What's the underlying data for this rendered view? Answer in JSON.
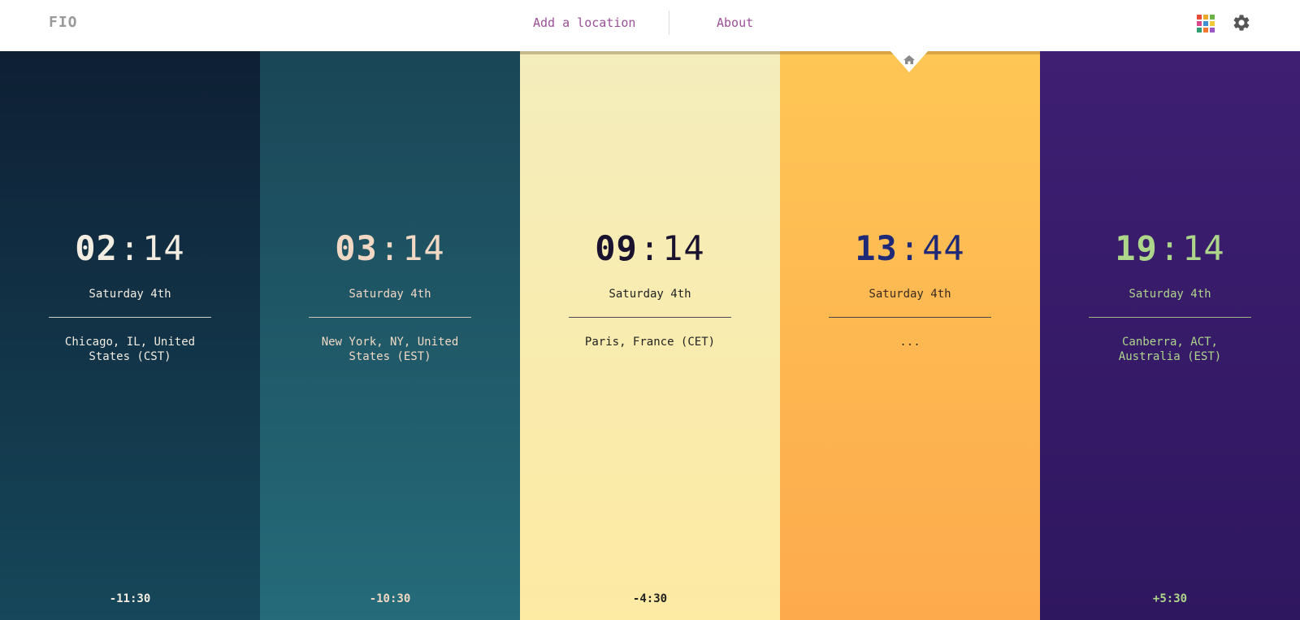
{
  "header": {
    "logo": "FIO",
    "add_location": "Add a location",
    "about": "About",
    "apps_icon": "apps-grid-icon",
    "settings_icon": "gear-icon",
    "accent_color": "#9b4f96"
  },
  "home_marker_icon": "home-icon",
  "locations": [
    {
      "hours": "02",
      "minutes": "14",
      "date": "Saturday 4th",
      "city": "Chicago, IL, United States (CST)",
      "offset": "-11:30",
      "background": "#0e1f34"
    },
    {
      "hours": "03",
      "minutes": "14",
      "date": "Saturday 4th",
      "city": "New York, NY, United States (EST)",
      "offset": "-10:30",
      "background": "#1a4657"
    },
    {
      "hours": "09",
      "minutes": "14",
      "date": "Saturday 4th",
      "city": "Paris, France (CET)",
      "offset": "-4:30",
      "background": "#f4edbc"
    },
    {
      "hours": "13",
      "minutes": "44",
      "date": "Saturday 4th",
      "city": "...",
      "offset": "",
      "background": "#fec655",
      "home": true
    },
    {
      "hours": "19",
      "minutes": "14",
      "date": "Saturday 4th",
      "city": "Canberra, ACT, Australia (EST)",
      "offset": "+5:30",
      "background": "#3e1f72"
    }
  ]
}
